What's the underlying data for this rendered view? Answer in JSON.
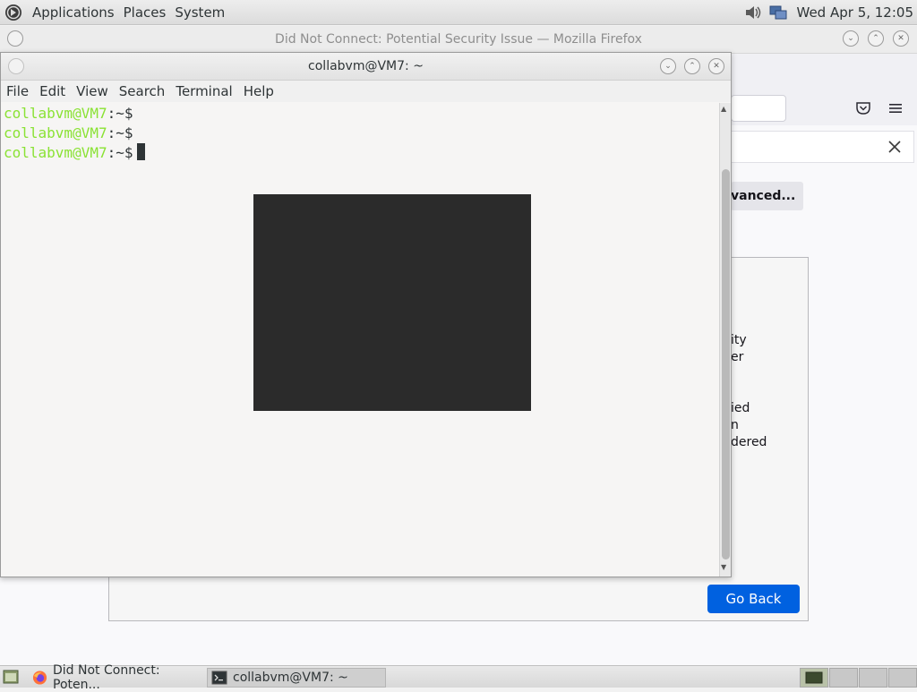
{
  "top_panel": {
    "menus": [
      "Applications",
      "Places",
      "System"
    ],
    "icons": [
      "distro-logo-icon",
      "volume-icon",
      "network-icon"
    ],
    "clock": "Wed Apr  5, 12:05"
  },
  "firefox": {
    "title": "Did Not Connect: Potential Security Issue — Mozilla Firefox",
    "advanced_label": "vanced...",
    "partial_lines": [
      "ity",
      "er",
      "ied",
      "n",
      "dered"
    ],
    "go_back_label": "Go Back",
    "accent": "#0061e0"
  },
  "terminal": {
    "title": "collabvm@VM7: ~",
    "menus": [
      "File",
      "Edit",
      "View",
      "Search",
      "Terminal",
      "Help"
    ],
    "prompt_user_host": "collabvm@VM7",
    "prompt_suffix": ":~$",
    "prompt_color": "#8ae234",
    "lines": 3
  },
  "taskbar": {
    "items": [
      {
        "label": "Did Not Connect: Poten...",
        "icon": "firefox-icon"
      },
      {
        "label": "collabvm@VM7: ~",
        "icon": "terminal-icon"
      }
    ],
    "show_desktop_icon": "show-desktop-icon"
  }
}
